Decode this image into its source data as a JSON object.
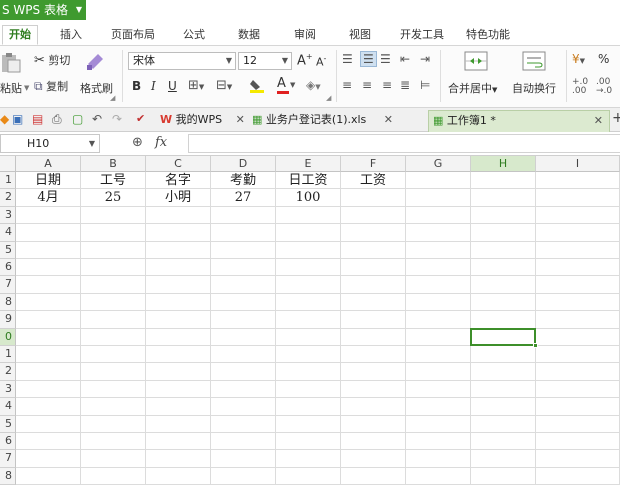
{
  "app": {
    "title": "S WPS 表格"
  },
  "menu": {
    "tabs": [
      "开始",
      "插入",
      "页面布局",
      "公式",
      "数据",
      "审阅",
      "视图",
      "开发工具",
      "特色功能"
    ]
  },
  "ribbon": {
    "paste_label": "粘贴",
    "cut_label": "剪切",
    "copy_label": "复制",
    "format_painter_label": "格式刷",
    "font_name": "宋体",
    "font_size": "12",
    "merge_center_label": "合并居中",
    "wrap_text_label": "自动换行",
    "percent_label": "%"
  },
  "docs": {
    "tabs": [
      {
        "label": "我的WPS"
      },
      {
        "label": "业务户登记表(1).xls"
      },
      {
        "label": "工作簿1 *"
      }
    ]
  },
  "formula": {
    "cell_ref": "H10",
    "fx_label": "fx",
    "value": ""
  },
  "sheet": {
    "columns": [
      "A",
      "B",
      "C",
      "D",
      "E",
      "F",
      "G",
      "H",
      "I"
    ],
    "selected_column": "H",
    "rows": [
      "1",
      "2",
      "3",
      "4",
      "5",
      "6",
      "7",
      "8",
      "9",
      "0",
      "1",
      "2",
      "3",
      "4",
      "5",
      "6",
      "7",
      "8"
    ],
    "selected_row_index": 9,
    "cells": [
      [
        "日期",
        "工号",
        "名字",
        "考勤",
        "日工资",
        "工资",
        "",
        "",
        ""
      ],
      [
        "4月",
        "25",
        "小明",
        "27",
        "100",
        "",
        "",
        "",
        ""
      ]
    ]
  },
  "colors": {
    "brand": "#3f9a2f",
    "selection": "#3d8f2a"
  }
}
